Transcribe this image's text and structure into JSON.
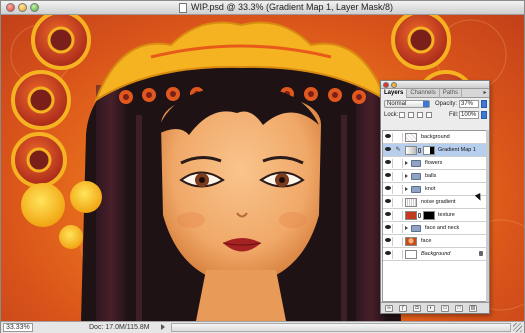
{
  "window": {
    "title": "WIP.psd @ 33.3% (Gradient Map 1, Layer Mask/8)"
  },
  "status": {
    "zoom": "33.33%",
    "doc_info": "Doc: 17.0M/115.8M"
  },
  "layers_panel": {
    "tabs": [
      {
        "label": "Layers",
        "active": true
      },
      {
        "label": "Channels",
        "active": false
      },
      {
        "label": "Paths",
        "active": false
      }
    ],
    "blend_mode": "Normal",
    "opacity_label": "Opacity:",
    "opacity_value": "37%",
    "lock_label": "Lock:",
    "fill_label": "Fill:",
    "fill_value": "100%",
    "layers": [
      {
        "name": "background",
        "type": "pattern",
        "visible": true,
        "selected": false
      },
      {
        "name": "Gradient Map 1",
        "type": "adjustment",
        "visible": true,
        "selected": true
      },
      {
        "name": "flowers",
        "type": "group",
        "visible": true,
        "selected": false
      },
      {
        "name": "balls",
        "type": "group",
        "visible": true,
        "selected": false
      },
      {
        "name": "knot",
        "type": "group",
        "visible": true,
        "selected": false
      },
      {
        "name": "noise gradient",
        "type": "noise",
        "visible": true,
        "selected": false
      },
      {
        "name": "texture",
        "type": "texture",
        "visible": true,
        "selected": false
      },
      {
        "name": "face and neck",
        "type": "group",
        "visible": true,
        "selected": false
      },
      {
        "name": "face",
        "type": "face",
        "visible": true,
        "selected": false
      },
      {
        "name": "Background",
        "type": "locked",
        "visible": true,
        "selected": false
      }
    ]
  },
  "colors": {
    "accent_blue": "#3d78d8",
    "selected_row": "#b7cfee",
    "canvas_orange": "#ee7a1e",
    "hair": "#1e1214"
  }
}
